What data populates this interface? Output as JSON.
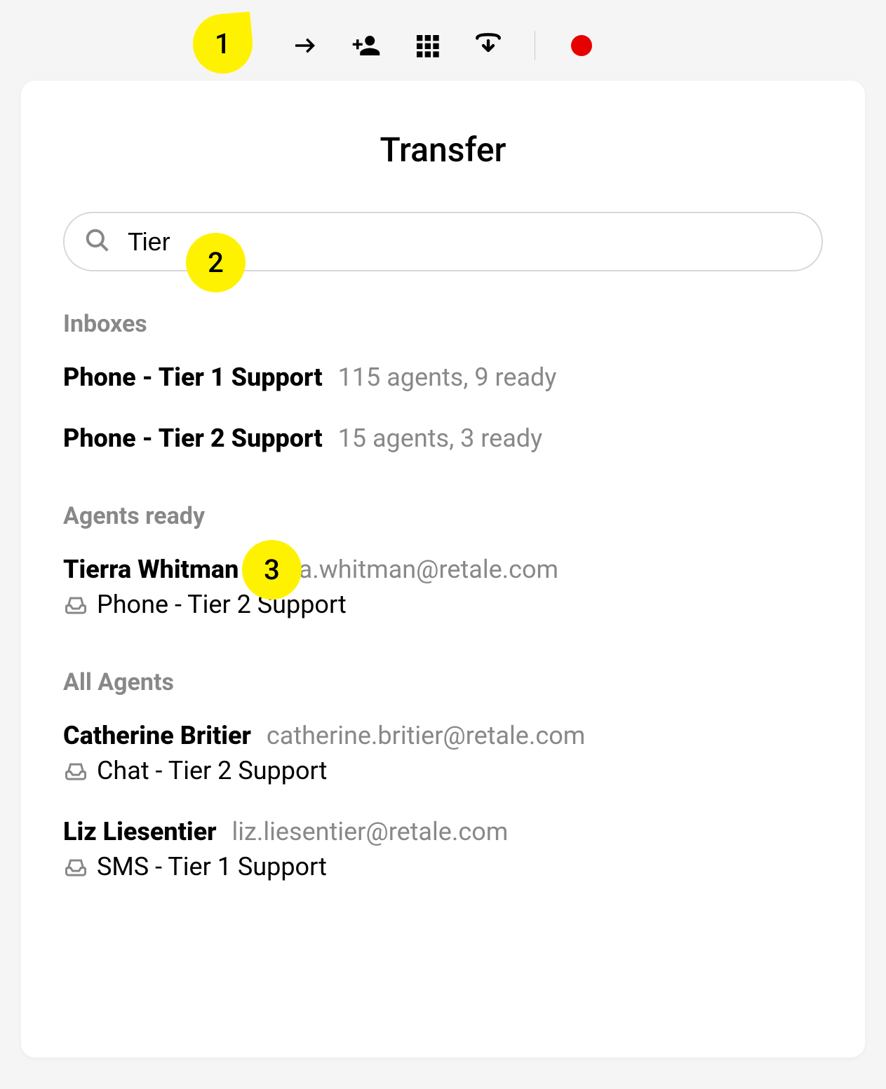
{
  "panel": {
    "title": "Transfer"
  },
  "search": {
    "value": "Tier"
  },
  "sections": {
    "inboxes_label": "Inboxes",
    "agents_ready_label": "Agents ready",
    "all_agents_label": "All Agents"
  },
  "inboxes": [
    {
      "name": "Phone - Tier 1 Support",
      "meta": "115 agents, 9 ready"
    },
    {
      "name": "Phone - Tier 2 Support",
      "meta": "15 agents, 3 ready"
    }
  ],
  "agents_ready": [
    {
      "name": "Tierra Whitman",
      "email": "tierra.whitman@retale.com",
      "inbox": "Phone - Tier 2 Support"
    }
  ],
  "all_agents": [
    {
      "name": "Catherine Britier",
      "email": "catherine.britier@retale.com",
      "inbox": "Chat - Tier 2 Support"
    },
    {
      "name": "Liz Liesentier",
      "email": "liz.liesentier@retale.com",
      "inbox": "SMS - Tier 1 Support"
    }
  ],
  "callouts": {
    "c1": "1",
    "c2": "2",
    "c3": "3"
  }
}
